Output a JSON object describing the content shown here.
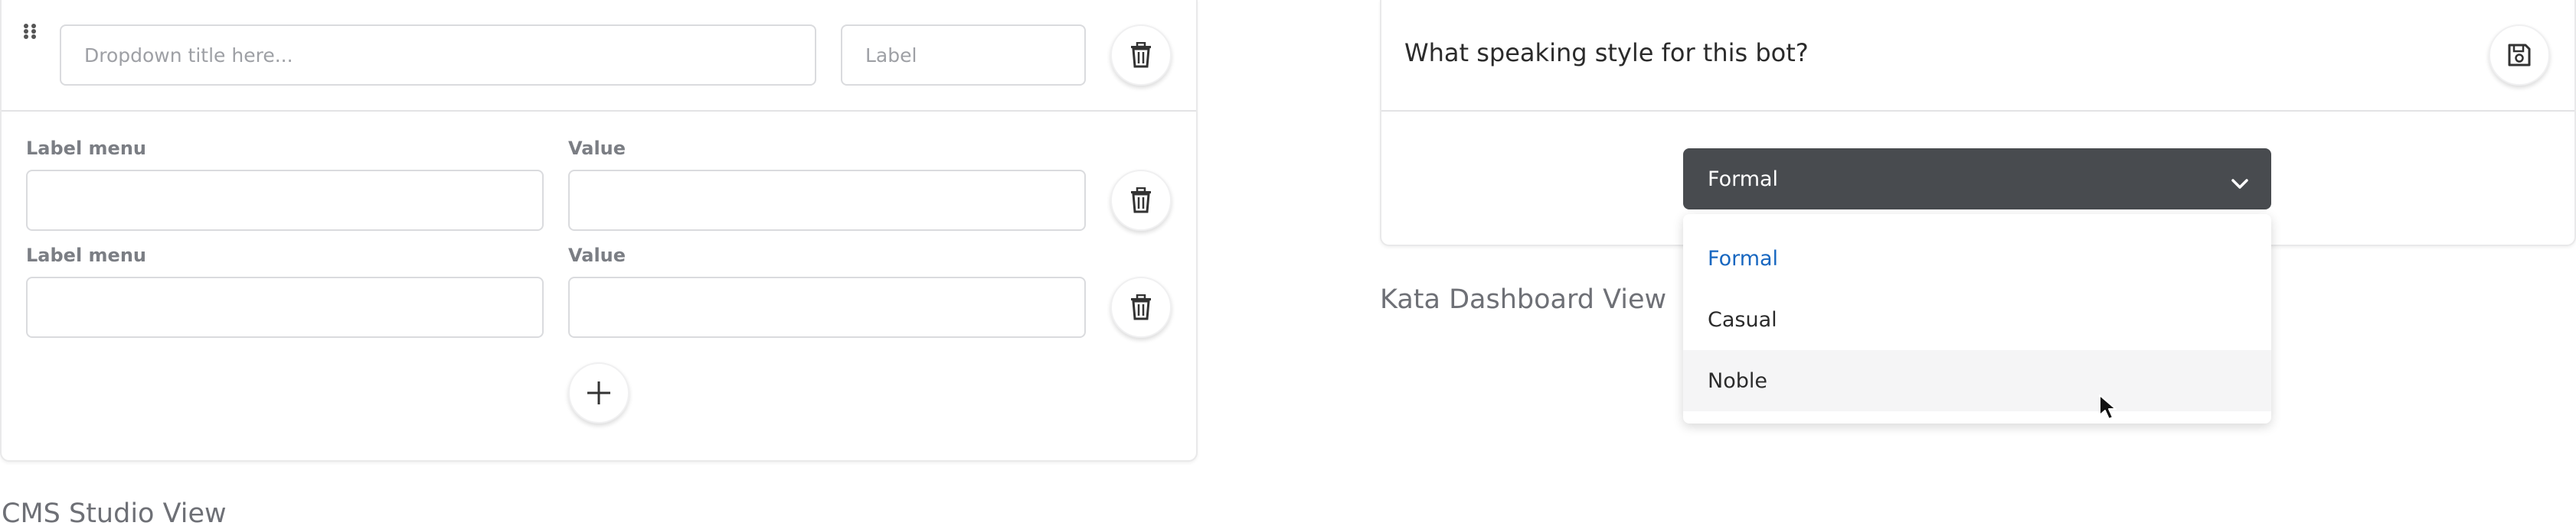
{
  "cms": {
    "caption": "CMS Studio View",
    "dropdown_title_placeholder": "Dropdown title here...",
    "label_placeholder": "Label",
    "rows": [
      {
        "label_header": "Label menu",
        "value_header": "Value"
      },
      {
        "label_header": "Label menu",
        "value_header": "Value"
      }
    ],
    "icons": {
      "drag": "drag-handle-icon",
      "delete": "trash-icon",
      "add": "plus-icon"
    }
  },
  "kata": {
    "caption": "Kata Dashboard View",
    "question": "What speaking style for this bot?",
    "selected_value": "Formal",
    "options": [
      "Formal",
      "Casual",
      "Noble"
    ],
    "hovered_option": "Noble",
    "icons": {
      "save": "floppy-disk-icon",
      "chevron": "chevron-down-icon",
      "cursor": "mouse-pointer-icon"
    },
    "colors": {
      "select_bg": "#484b4f",
      "selected_option": "#1867c0"
    }
  }
}
